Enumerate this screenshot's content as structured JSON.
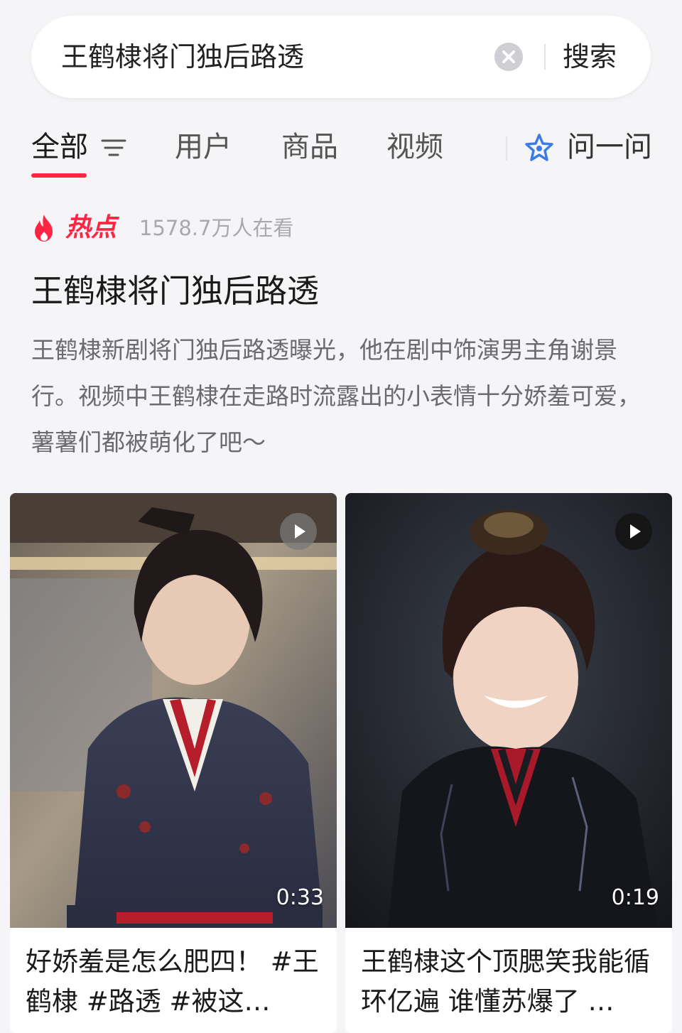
{
  "search": {
    "query": "王鹤棣将门独后路透",
    "submit_label": "搜索"
  },
  "tabs": [
    {
      "label": "全部",
      "active": true
    },
    {
      "label": "用户",
      "active": false
    },
    {
      "label": "商品",
      "active": false
    },
    {
      "label": "视频",
      "active": false
    },
    {
      "label": "问一问",
      "active": false
    }
  ],
  "hot": {
    "badge": "热点",
    "viewers": "1578.7万人在看",
    "title": "王鹤棣将门独后路透",
    "description": "王鹤棣新剧将门独后路透曝光，他在剧中饰演男主角谢景行。视频中王鹤棣在走路时流露出的小表情十分娇羞可爱，薯薯们都被萌化了吧～"
  },
  "cards": [
    {
      "duration": "0:33",
      "title": "好娇羞是怎么肥四！ #王鹤棣 #路透 #被这…"
    },
    {
      "duration": "0:19",
      "title": "王鹤棣这个顶腮笑我能循环亿遍 谁懂苏爆了 …"
    }
  ],
  "colors": {
    "accent": "#ff2442",
    "ask_icon": "#3b7be8",
    "background": "#f5f5f7"
  },
  "icons": {
    "clear": "clear-icon",
    "filter": "filter-icon",
    "ask": "ask-star-icon",
    "hot": "flame-icon",
    "play": "play-icon"
  }
}
